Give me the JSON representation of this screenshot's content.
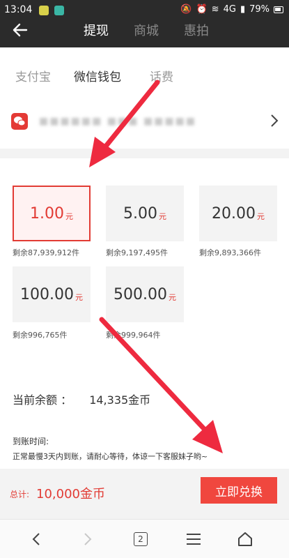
{
  "status_bar": {
    "time": "13:04",
    "network": "4G",
    "battery": "79%"
  },
  "header": {
    "tabs": [
      {
        "label": "提现",
        "active": true
      },
      {
        "label": "商城",
        "active": false
      },
      {
        "label": "惠拍",
        "active": false
      }
    ]
  },
  "method_tabs": [
    {
      "label": "支付宝",
      "active": false
    },
    {
      "label": "微信钱包",
      "active": true
    },
    {
      "label": "话费",
      "active": false
    }
  ],
  "account": {
    "masked_text": "■■■■■■ ■■■ ■■■■■"
  },
  "amounts": [
    {
      "value": "1.00",
      "unit": "元",
      "remaining": "剩余87,939,912件",
      "selected": true
    },
    {
      "value": "5.00",
      "unit": "元",
      "remaining": "剩余9,197,495件",
      "selected": false
    },
    {
      "value": "20.00",
      "unit": "元",
      "remaining": "剩余9,893,366件",
      "selected": false
    },
    {
      "value": "100.00",
      "unit": "元",
      "remaining": "剩余996,765件",
      "selected": false
    },
    {
      "value": "500.00",
      "unit": "元",
      "remaining": "剩余999,964件",
      "selected": false
    }
  ],
  "balance": {
    "label": "当前余额 ：",
    "value": "14,335金币"
  },
  "arrival": {
    "title": "到账时间:",
    "text": "正常最慢3天内到账，请耐心等待，体谅一下客服妹子哟~"
  },
  "footer": {
    "total_label": "总计:",
    "total_value": "10,000金币",
    "redeem_label": "立即兑换"
  },
  "nav": {
    "tab_count": "2"
  },
  "colors": {
    "accent": "#e23b34",
    "button": "#f0473e",
    "header_bg": "#2b2b2b",
    "arrow": "#ee2a3f"
  }
}
